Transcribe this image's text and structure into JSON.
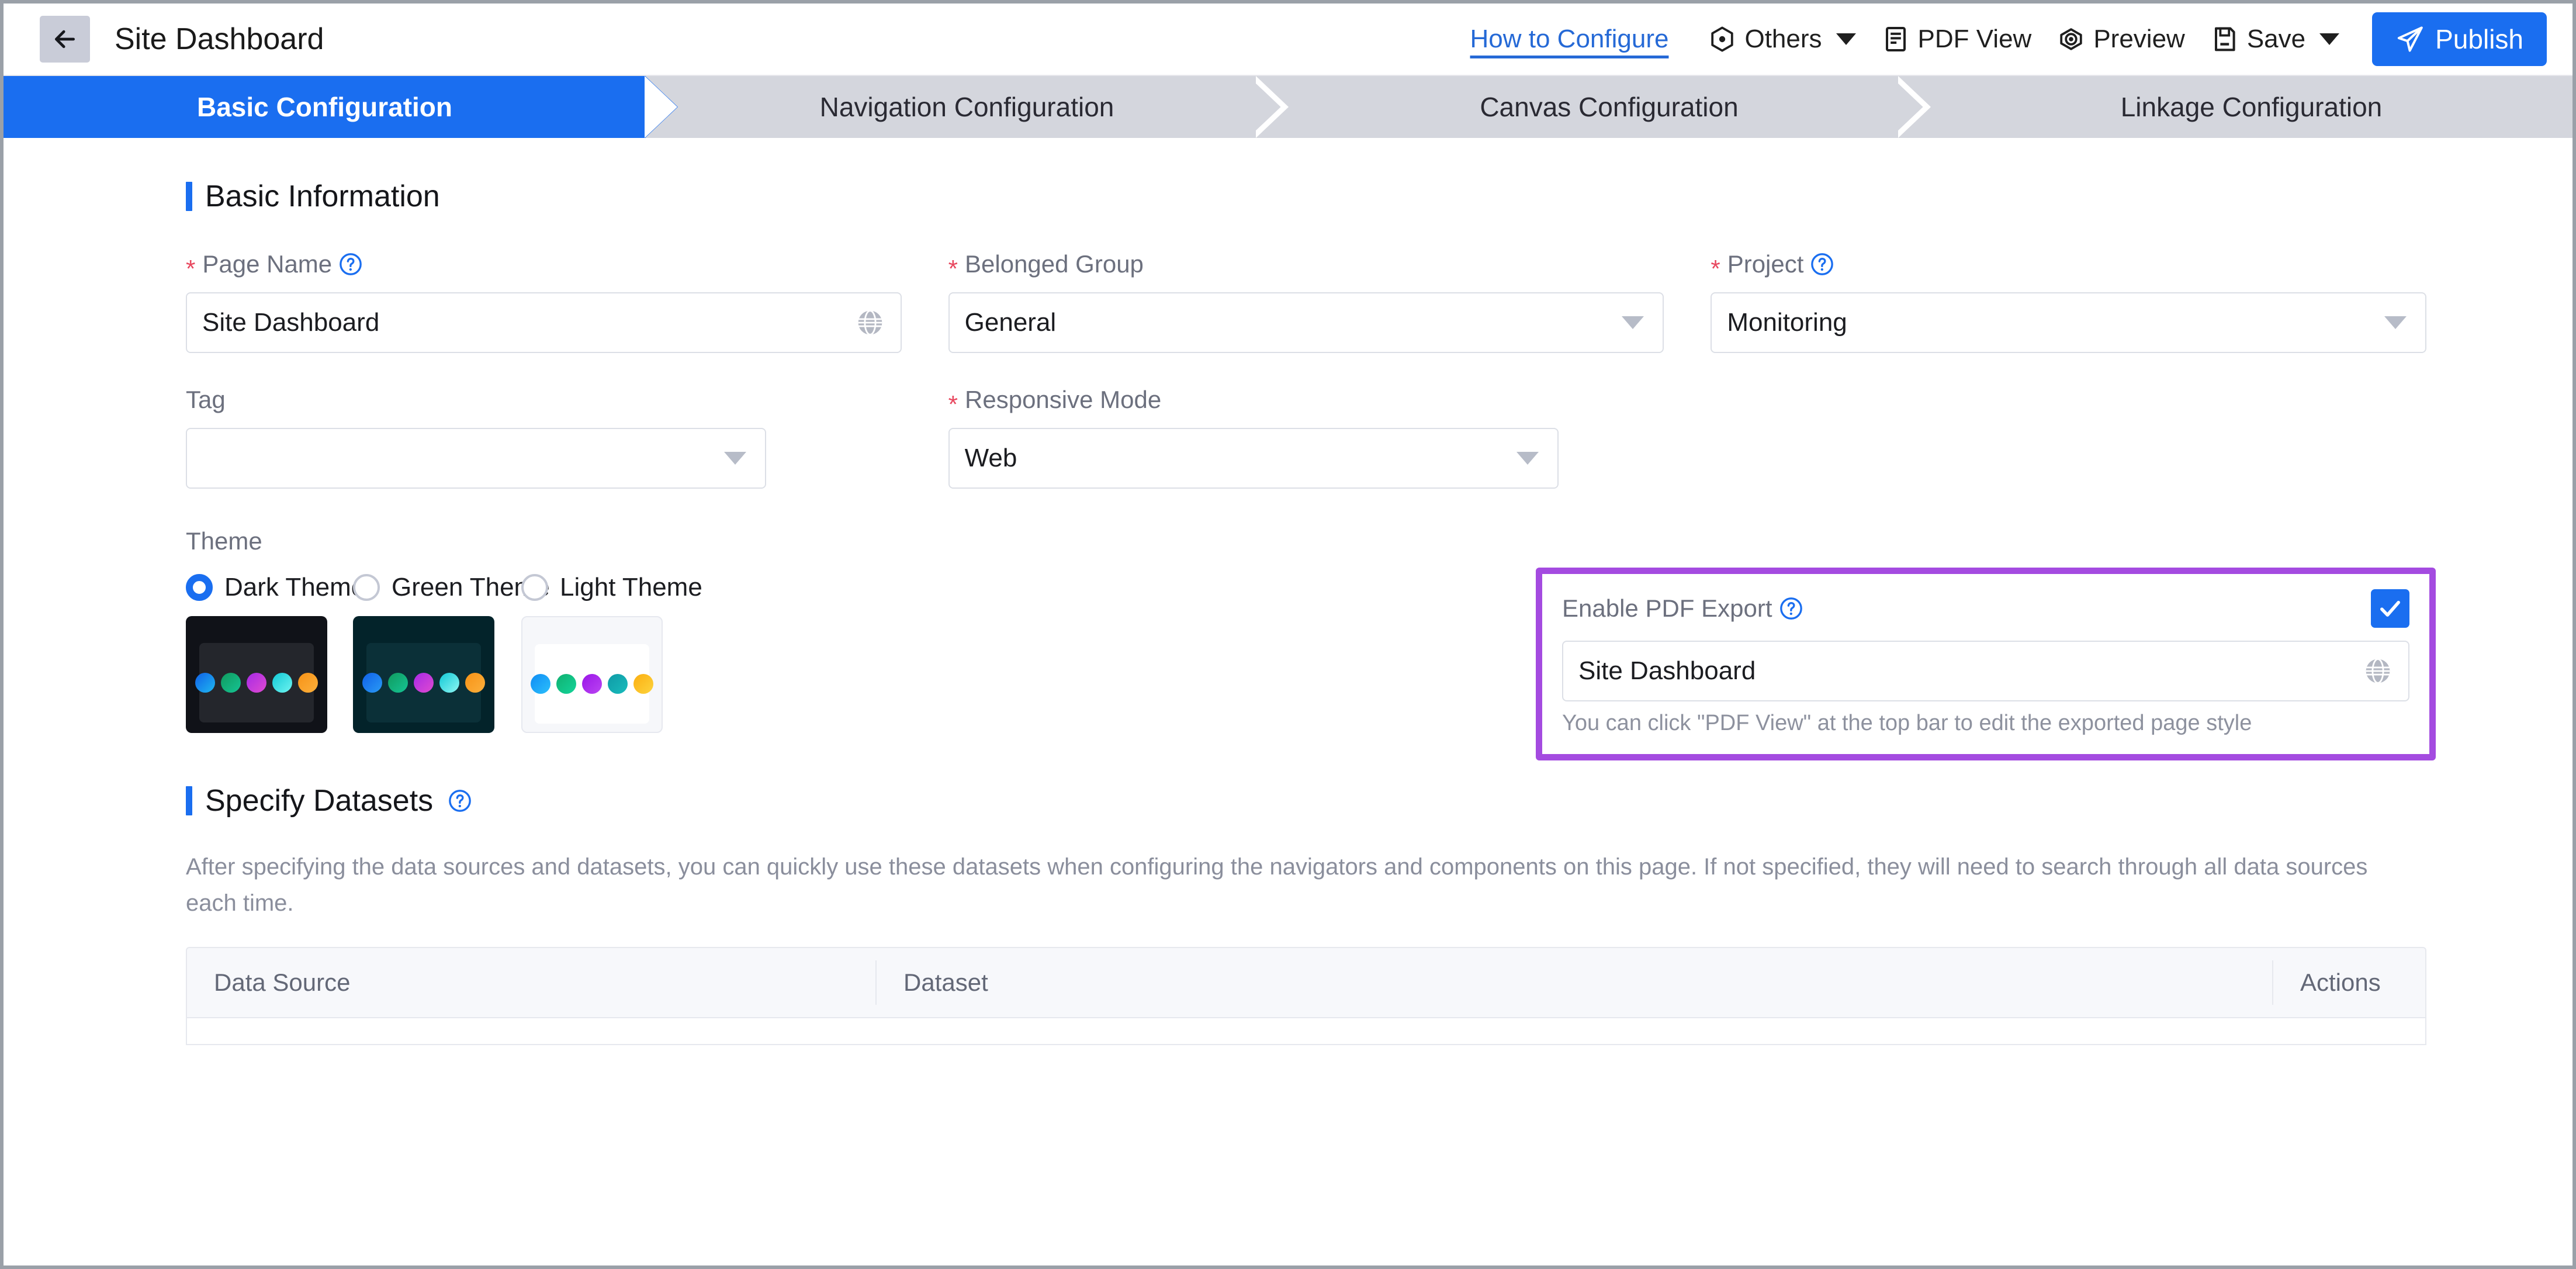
{
  "topbar": {
    "back_icon": "arrow-left-icon",
    "title": "Site Dashboard",
    "how_to_configure": "How to Configure",
    "others": "Others",
    "pdf_view": "PDF View",
    "preview": "Preview",
    "save": "Save",
    "publish": "Publish"
  },
  "steps": [
    {
      "label": "Basic Configuration",
      "active": true
    },
    {
      "label": "Navigation Configuration",
      "active": false
    },
    {
      "label": "Canvas Configuration",
      "active": false
    },
    {
      "label": "Linkage Configuration",
      "active": false
    }
  ],
  "basic_information": {
    "heading": "Basic Information",
    "page_name": {
      "label": "Page Name",
      "value": "Site Dashboard",
      "required": true,
      "has_help": true,
      "trailing_icon": "globe-icon"
    },
    "belonged_group": {
      "label": "Belonged Group",
      "value": "General",
      "required": true,
      "has_help": false
    },
    "project": {
      "label": "Project",
      "value": "Monitoring",
      "required": true,
      "has_help": true
    },
    "tag": {
      "label": "Tag",
      "value": "",
      "required": false,
      "has_help": false
    },
    "responsive_mode": {
      "label": "Responsive Mode",
      "value": "Web",
      "required": true,
      "has_help": false
    },
    "enable_pdf_export": {
      "label": "Enable PDF Export",
      "has_help": true,
      "checked": true,
      "value": "Site Dashboard",
      "trailing_icon": "globe-icon",
      "hint": "You can click \"PDF View\" at the top bar to edit the exported page style",
      "highlight_color": "#a44be0"
    },
    "theme": {
      "label": "Theme",
      "options": [
        {
          "label": "Dark Theme",
          "selected": true,
          "card_bg": "#101218",
          "inner_bg": "#24262c",
          "dots": [
            "#1f86f0",
            "#12a47a",
            "#c13ae0",
            "#1edbe0",
            "#f79a1e"
          ]
        },
        {
          "label": "Green Theme",
          "selected": false,
          "card_bg": "#03232a",
          "inner_bg": "#0b3038",
          "dots": [
            "#1f86f0",
            "#12a47a",
            "#c13ae0",
            "#1edbe0",
            "#f79a1e"
          ]
        },
        {
          "label": "Light Theme",
          "selected": false,
          "card_bg": "#f6f7fa",
          "inner_bg": "#ffffff",
          "dots": [
            "#16a6f5",
            "#12c48a",
            "#a72ae8",
            "#12a8ad",
            "#fbbd23"
          ]
        }
      ]
    }
  },
  "specify_datasets": {
    "heading": "Specify Datasets",
    "has_help": true,
    "description": "After specifying the data sources and datasets, you can quickly use these datasets when configuring the navigators and components on this page. If not specified, they will need to search through all data sources each time.",
    "table": {
      "columns": [
        "Data Source",
        "Dataset",
        "Actions"
      ],
      "rows": []
    }
  },
  "colors": {
    "accent_blue": "#1a6ef0",
    "link_blue": "#2569d6",
    "required_red": "#e8485f",
    "highlight_purple": "#a44be0",
    "step_inactive": "#d4d6dd"
  }
}
